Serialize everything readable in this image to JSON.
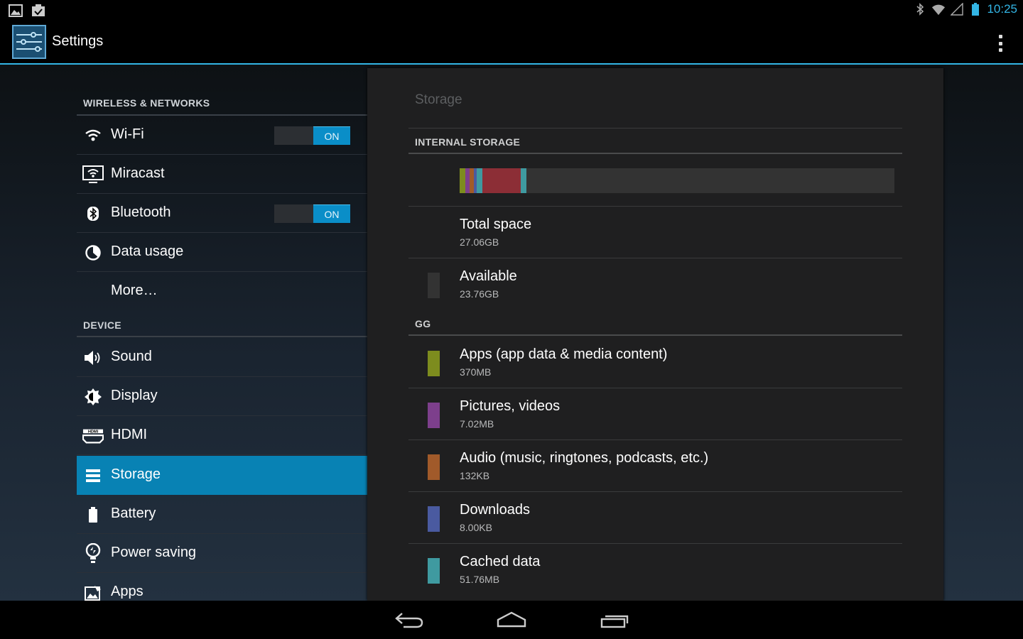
{
  "status_bar": {
    "time": "10:25",
    "left_icons": [
      "gallery-notification-icon",
      "task-notification-icon"
    ],
    "right_icons": [
      "bluetooth-icon",
      "wifi-icon",
      "signal-icon",
      "battery-icon"
    ]
  },
  "action_bar": {
    "title": "Settings",
    "icon": "settings-sliders-icon",
    "overflow_icon": "overflow-menu-icon"
  },
  "sidebar": {
    "wireless_header": "WIRELESS & NETWORKS",
    "device_header": "DEVICE",
    "wireless_items": [
      {
        "label": "Wi-Fi",
        "icon": "wifi-icon",
        "toggle": "ON"
      },
      {
        "label": "Miracast",
        "icon": "miracast-icon"
      },
      {
        "label": "Bluetooth",
        "icon": "bluetooth-icon",
        "toggle": "ON"
      },
      {
        "label": "Data usage",
        "icon": "data-usage-icon"
      },
      {
        "label": "More…"
      }
    ],
    "device_items": [
      {
        "label": "Sound",
        "icon": "sound-icon"
      },
      {
        "label": "Display",
        "icon": "display-icon"
      },
      {
        "label": "HDMI",
        "icon": "hdmi-icon"
      },
      {
        "label": "Storage",
        "icon": "storage-icon",
        "selected": true
      },
      {
        "label": "Battery",
        "icon": "battery-icon"
      },
      {
        "label": "Power saving",
        "icon": "power-saving-icon"
      },
      {
        "label": "Apps",
        "icon": "apps-icon"
      }
    ]
  },
  "storage": {
    "title": "Storage",
    "internal_header": "INTERNAL STORAGE",
    "usage_bar": {
      "segments_percent": [
        {
          "color": "#7d8c1e",
          "pct": 1.3
        },
        {
          "color": "#7d3f8c",
          "pct": 1.0
        },
        {
          "color": "#a15a2a",
          "pct": 1.0
        },
        {
          "color": "#4a5aa0",
          "pct": 0.7
        },
        {
          "color": "#3f9aa0",
          "pct": 1.3
        },
        {
          "color": "#8c2e36",
          "pct": 8.8
        },
        {
          "color": "#3f9aa0",
          "pct": 1.2
        }
      ],
      "remaining_color": "#333333"
    },
    "total": {
      "label": "Total space",
      "value": "27.06GB"
    },
    "available": {
      "label": "Available",
      "value": "23.76GB",
      "color": "#333333"
    },
    "user_header": "GG",
    "categories": [
      {
        "label": "Apps (app data & media content)",
        "value": "370MB",
        "color": "#7d8c1e"
      },
      {
        "label": "Pictures, videos",
        "value": "7.02MB",
        "color": "#7d3f8c"
      },
      {
        "label": "Audio (music, ringtones, podcasts, etc.)",
        "value": "132KB",
        "color": "#a15a2a"
      },
      {
        "label": "Downloads",
        "value": "8.00KB",
        "color": "#4a5aa0"
      },
      {
        "label": "Cached data",
        "value": "51.76MB",
        "color": "#3f9aa0"
      }
    ]
  },
  "nav_bar": {
    "icons": [
      "back-icon",
      "home-icon",
      "recent-apps-icon"
    ]
  },
  "colors": {
    "accent": "#33b5e5",
    "selected_item": "#0882b4",
    "toggle_on": "#0a8ec8"
  }
}
